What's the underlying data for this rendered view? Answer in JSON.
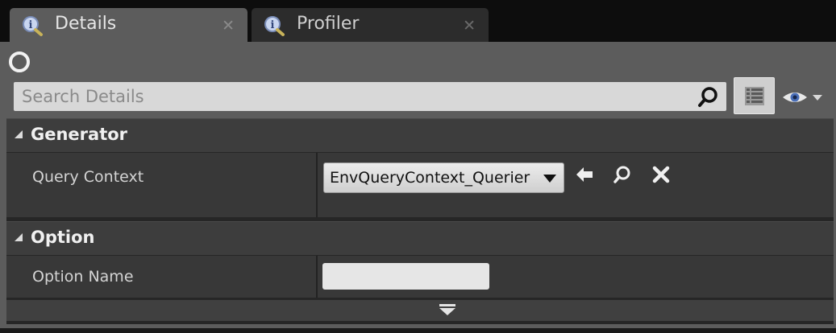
{
  "tabs": [
    {
      "label": "Details",
      "active": true,
      "icon": "details-magnifier-icon"
    },
    {
      "label": "Profiler",
      "active": false,
      "icon": "profiler-magnifier-icon"
    }
  ],
  "toolbar": {
    "throbber_icon": "loading-circle-icon",
    "search": {
      "placeholder": "Search Details",
      "value": ""
    },
    "view_options_icon": "property-matrix-icon",
    "visibility_icon": "eye-icon"
  },
  "categories": [
    {
      "label": "Generator",
      "rows": [
        {
          "label": "Query Context",
          "dropdown_value": "EnvQueryContext_Querier",
          "actions": [
            "use-selected-arrow-icon",
            "browse-magnifier-icon",
            "clear-x-icon"
          ]
        }
      ]
    },
    {
      "label": "Option",
      "rows": [
        {
          "label": "Option Name",
          "value": ""
        }
      ]
    }
  ],
  "advanced_toggle_icon": "expand-advanced-arrow-icon",
  "colors": {
    "tab_active": "#5c5c5c",
    "tab_inactive": "#2c2c2c",
    "panel": "#5c5c5c",
    "category_header": "#3d3d3d",
    "row": "#383838",
    "search_bg": "#d8d8d8"
  }
}
